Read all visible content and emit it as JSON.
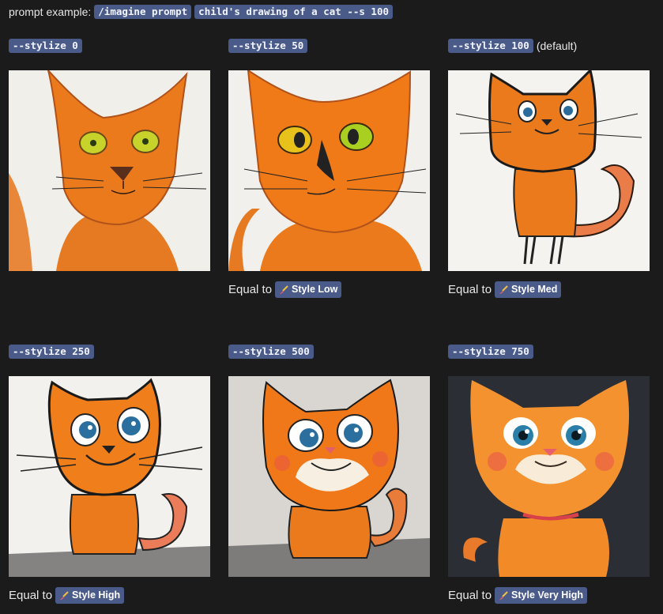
{
  "prompt_row": {
    "label": "prompt example:",
    "command": "/imagine prompt",
    "text": "child's drawing of a cat --s 100"
  },
  "cells": [
    {
      "param": "--stylize 0",
      "suffix": "",
      "equal_to": "",
      "style": ""
    },
    {
      "param": "--stylize 50",
      "suffix": "",
      "equal_to": "Equal to",
      "style": "Style Low"
    },
    {
      "param": "--stylize 100",
      "suffix": "(default)",
      "equal_to": "Equal to",
      "style": "Style Med"
    },
    {
      "param": "--stylize 250",
      "suffix": "",
      "equal_to": "Equal to",
      "style": "Style High"
    },
    {
      "param": "--stylize 500",
      "suffix": "",
      "equal_to": "",
      "style": ""
    },
    {
      "param": "--stylize 750",
      "suffix": "",
      "equal_to": "Equal to",
      "style": "Style Very High"
    }
  ],
  "colors": {
    "background": "#1b1b1c",
    "badge": "#4a5b8a",
    "cat_orange": "#ea7a1c"
  }
}
